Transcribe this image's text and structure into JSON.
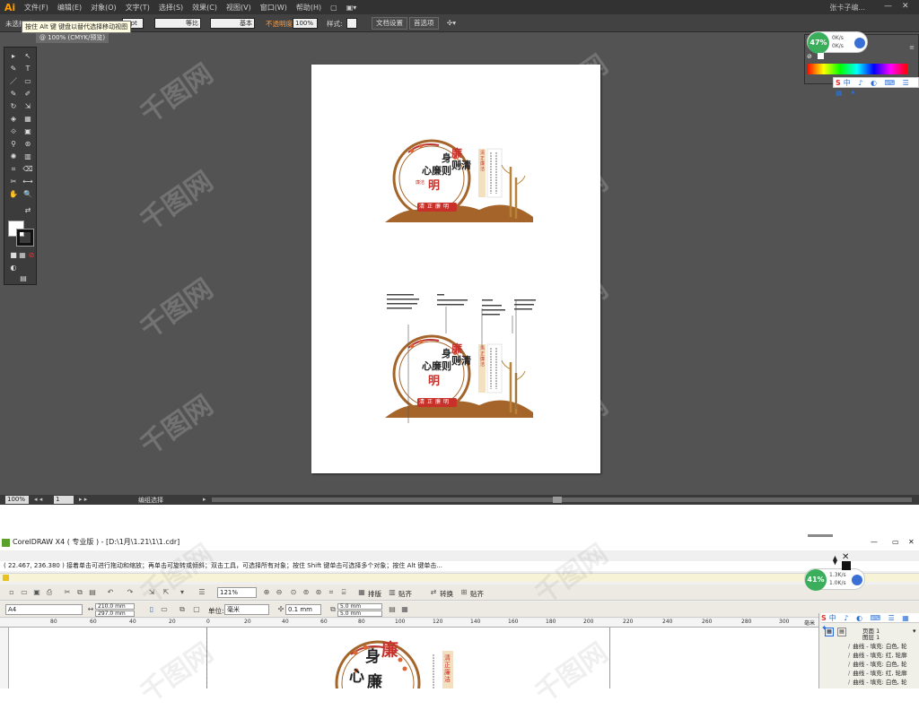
{
  "illustrator": {
    "logo": "Ai",
    "menus": [
      "文件(F)",
      "编辑(E)",
      "对象(O)",
      "文字(T)",
      "选择(S)",
      "效果(C)",
      "视图(V)",
      "窗口(W)",
      "帮助(H)"
    ],
    "extra_menu": "▣▾",
    "user": "张卡子编...",
    "win_minimize": "—",
    "win_close": "✕",
    "control_bar": {
      "selection_label": "未选择对",
      "stroke_weight": "1 pt",
      "stroke_profile": "等比",
      "brush": "基本",
      "opacity_label": "不透明度",
      "opacity_value": "100%",
      "style_label": "样式:",
      "doc_setup": "文档设置",
      "preferences": "首选项"
    },
    "tooltip": "按住 Alt 键 键盘以替代选择移动视图",
    "doc_tab": "@ 100% (CMYK/预览)",
    "tools": [
      "▸",
      "↖",
      "✎",
      "T",
      "／",
      "▭",
      "✎",
      "✐",
      "↻",
      "⇲",
      "◈",
      "▦",
      "⟐",
      "▣",
      "✋",
      "🔍"
    ],
    "status_bar": {
      "zoom": "100%",
      "page": "1",
      "mode": "编组选择"
    },
    "speed_badge": {
      "percent": "47%",
      "up": "0K/s",
      "down": "0K/s"
    },
    "ime_bar": {
      "logo": "S",
      "items": "中 ♪ ◐ ⌨ ☰ ▦ ✦"
    },
    "artwork": {
      "title_chars": [
        "身",
        "廉",
        "则",
        "清",
        "心",
        "廉",
        "则",
        "明"
      ],
      "banner": "清正廉明",
      "tag": "廉洁",
      "side_title": "清正廉洁"
    }
  },
  "coreldraw": {
    "title": "CorelDRAW X4 ( 专业版 ) - [D:\\1月\\1.21\\1\\1.cdr]",
    "window_controls": [
      "—",
      "▭",
      "✕"
    ],
    "info_bar": "( 22.467, 236.380 )      接着单击可进行拖动和缩放；再单击可旋转或倾斜；双击工具，可选择所有对象；按住 Shift 键单击可选择多个对象；按住 Alt 键单击...",
    "zoom": "121%",
    "toolbar_labels": {
      "arrange": "排版",
      "align": "贴齐",
      "transform": "转换",
      "snap": "贴齐"
    },
    "page_size": "A4",
    "width": "210.0 mm",
    "height": "297.0 mm",
    "unit_label": "单位:",
    "unit": "毫米",
    "nudge": "0.1 mm",
    "dup_x": "5.0 mm",
    "dup_y": "5.0 mm",
    "speed_badge": {
      "percent": "41%",
      "up": "1.3K/s",
      "down": "1.0K/s"
    },
    "ruler_ticks": [
      "80",
      "60",
      "40",
      "20",
      "0",
      "20",
      "40",
      "60",
      "80",
      "100",
      "120",
      "140",
      "160",
      "180",
      "200",
      "220",
      "240",
      "260",
      "280",
      "300"
    ],
    "ruler_unit": "毫米",
    "layers": {
      "page": "页面 1",
      "layer": "图层 1"
    },
    "object_rows": [
      "曲线 - 填充: 白色, 轮",
      "曲线 - 填充: 红, 轮廓",
      "曲线 - 填充: 白色, 轮",
      "曲线 - 填充: 红, 轮廓",
      "曲线 - 填充: 白色, 轮"
    ],
    "artwork": {
      "chars": [
        "身",
        "廉",
        "心",
        "廉"
      ],
      "side": "清正廉洁"
    }
  },
  "watermark": "千图网"
}
